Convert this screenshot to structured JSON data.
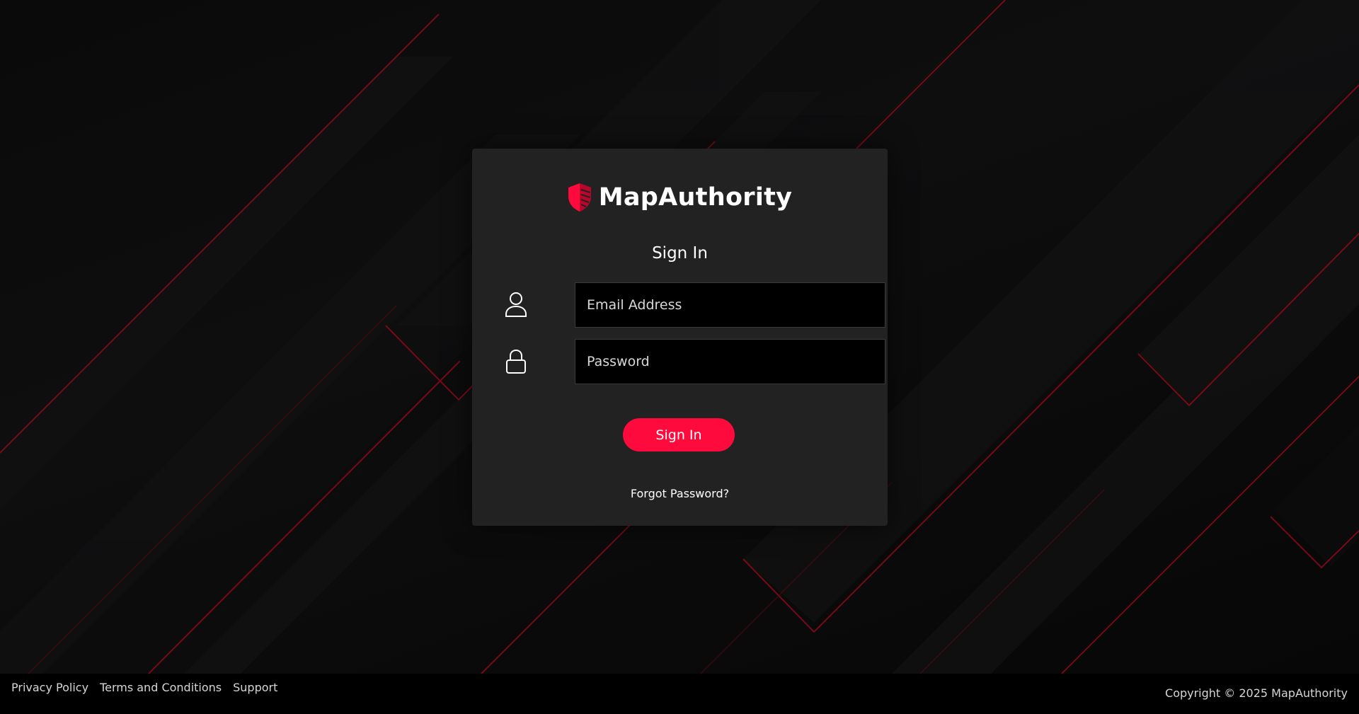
{
  "brand": {
    "name": "MapAuthority",
    "accent_color": "#ff0a3c",
    "logo_icon": "shield-icon"
  },
  "signin": {
    "title": "Sign In",
    "email": {
      "placeholder": "Email Address",
      "value": "",
      "icon": "user-icon"
    },
    "password": {
      "placeholder": "Password",
      "value": "",
      "icon": "lock-icon"
    },
    "submit_label": "Sign In",
    "forgot_label": "Forgot Password?"
  },
  "footer": {
    "links": [
      "Privacy Policy",
      "Terms and Conditions",
      "Support"
    ],
    "copyright": "Copyright © 2025 MapAuthority"
  }
}
